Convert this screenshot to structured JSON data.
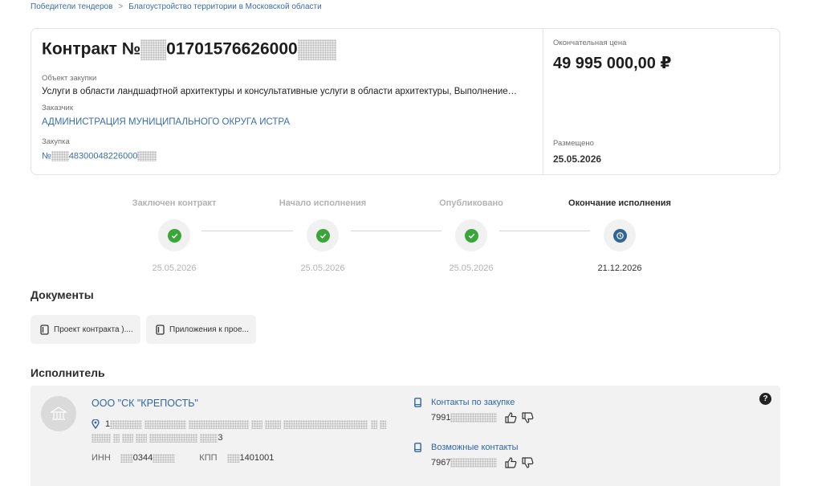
{
  "breadcrumb": {
    "items": [
      "Победители тендеров",
      "Благоустройство территории в Московской области"
    ],
    "separator": ">"
  },
  "contract": {
    "title_prefix": "Контракт №",
    "number_visible": "01701576626000",
    "object_label": "Объект закупки",
    "object_value": "Услуги в области ландшафтной архитектуры и консультативные услуги в области архитектуры, Выполнение…",
    "customer_label": "Заказчик",
    "customer_value": "АДМИНИСТРАЦИЯ МУНИЦИПАЛЬНОГО ОКРУГА ИСТРА",
    "purchase_label": "Закупка",
    "purchase_prefix": "№",
    "purchase_value": "48300048226000",
    "final_price_label": "Окончательная цена",
    "final_price_value": "49 995 000,00 ₽",
    "published_label": "Размещено",
    "published_value": "25.05.2026"
  },
  "timeline": [
    {
      "label": "Заключен контракт",
      "date": "25.05.2026",
      "status": "done"
    },
    {
      "label": "Начало исполнения",
      "date": "25.05.2026",
      "status": "done"
    },
    {
      "label": "Опубликовано",
      "date": "25.05.2026",
      "status": "done"
    },
    {
      "label": "Окончание исполнения",
      "date": "21.12.2026",
      "status": "pending"
    }
  ],
  "documents": {
    "title": "Документы",
    "items": [
      {
        "name": "Проект контракта )...."
      },
      {
        "name": "Приложения к прое..."
      }
    ]
  },
  "executor": {
    "title": "Исполнитель",
    "company": "ООО \"СК \"КРЕПОСТЬ\"",
    "address_start": "1",
    "address_end": "3",
    "inn_label": "ИНН",
    "inn_visible": "0344",
    "kpp_label": "КПП",
    "kpp_visible": "1401001",
    "contacts": [
      {
        "title": "Контакты по закупке",
        "phone_visible": "7991"
      },
      {
        "title": "Возможные контакты",
        "phone_visible": "7967"
      }
    ],
    "help": "?"
  },
  "icons": {
    "document": "document-icon",
    "building": "building-icon",
    "location": "location-pin-icon",
    "phone": "phone-icon",
    "like": "thumb-up-icon",
    "dislike": "thumb-down-icon",
    "check": "check-icon",
    "history": "history-icon"
  },
  "colors": {
    "link": "#3a6ea5",
    "done": "#3aa53a",
    "pending": "#2f6694"
  }
}
